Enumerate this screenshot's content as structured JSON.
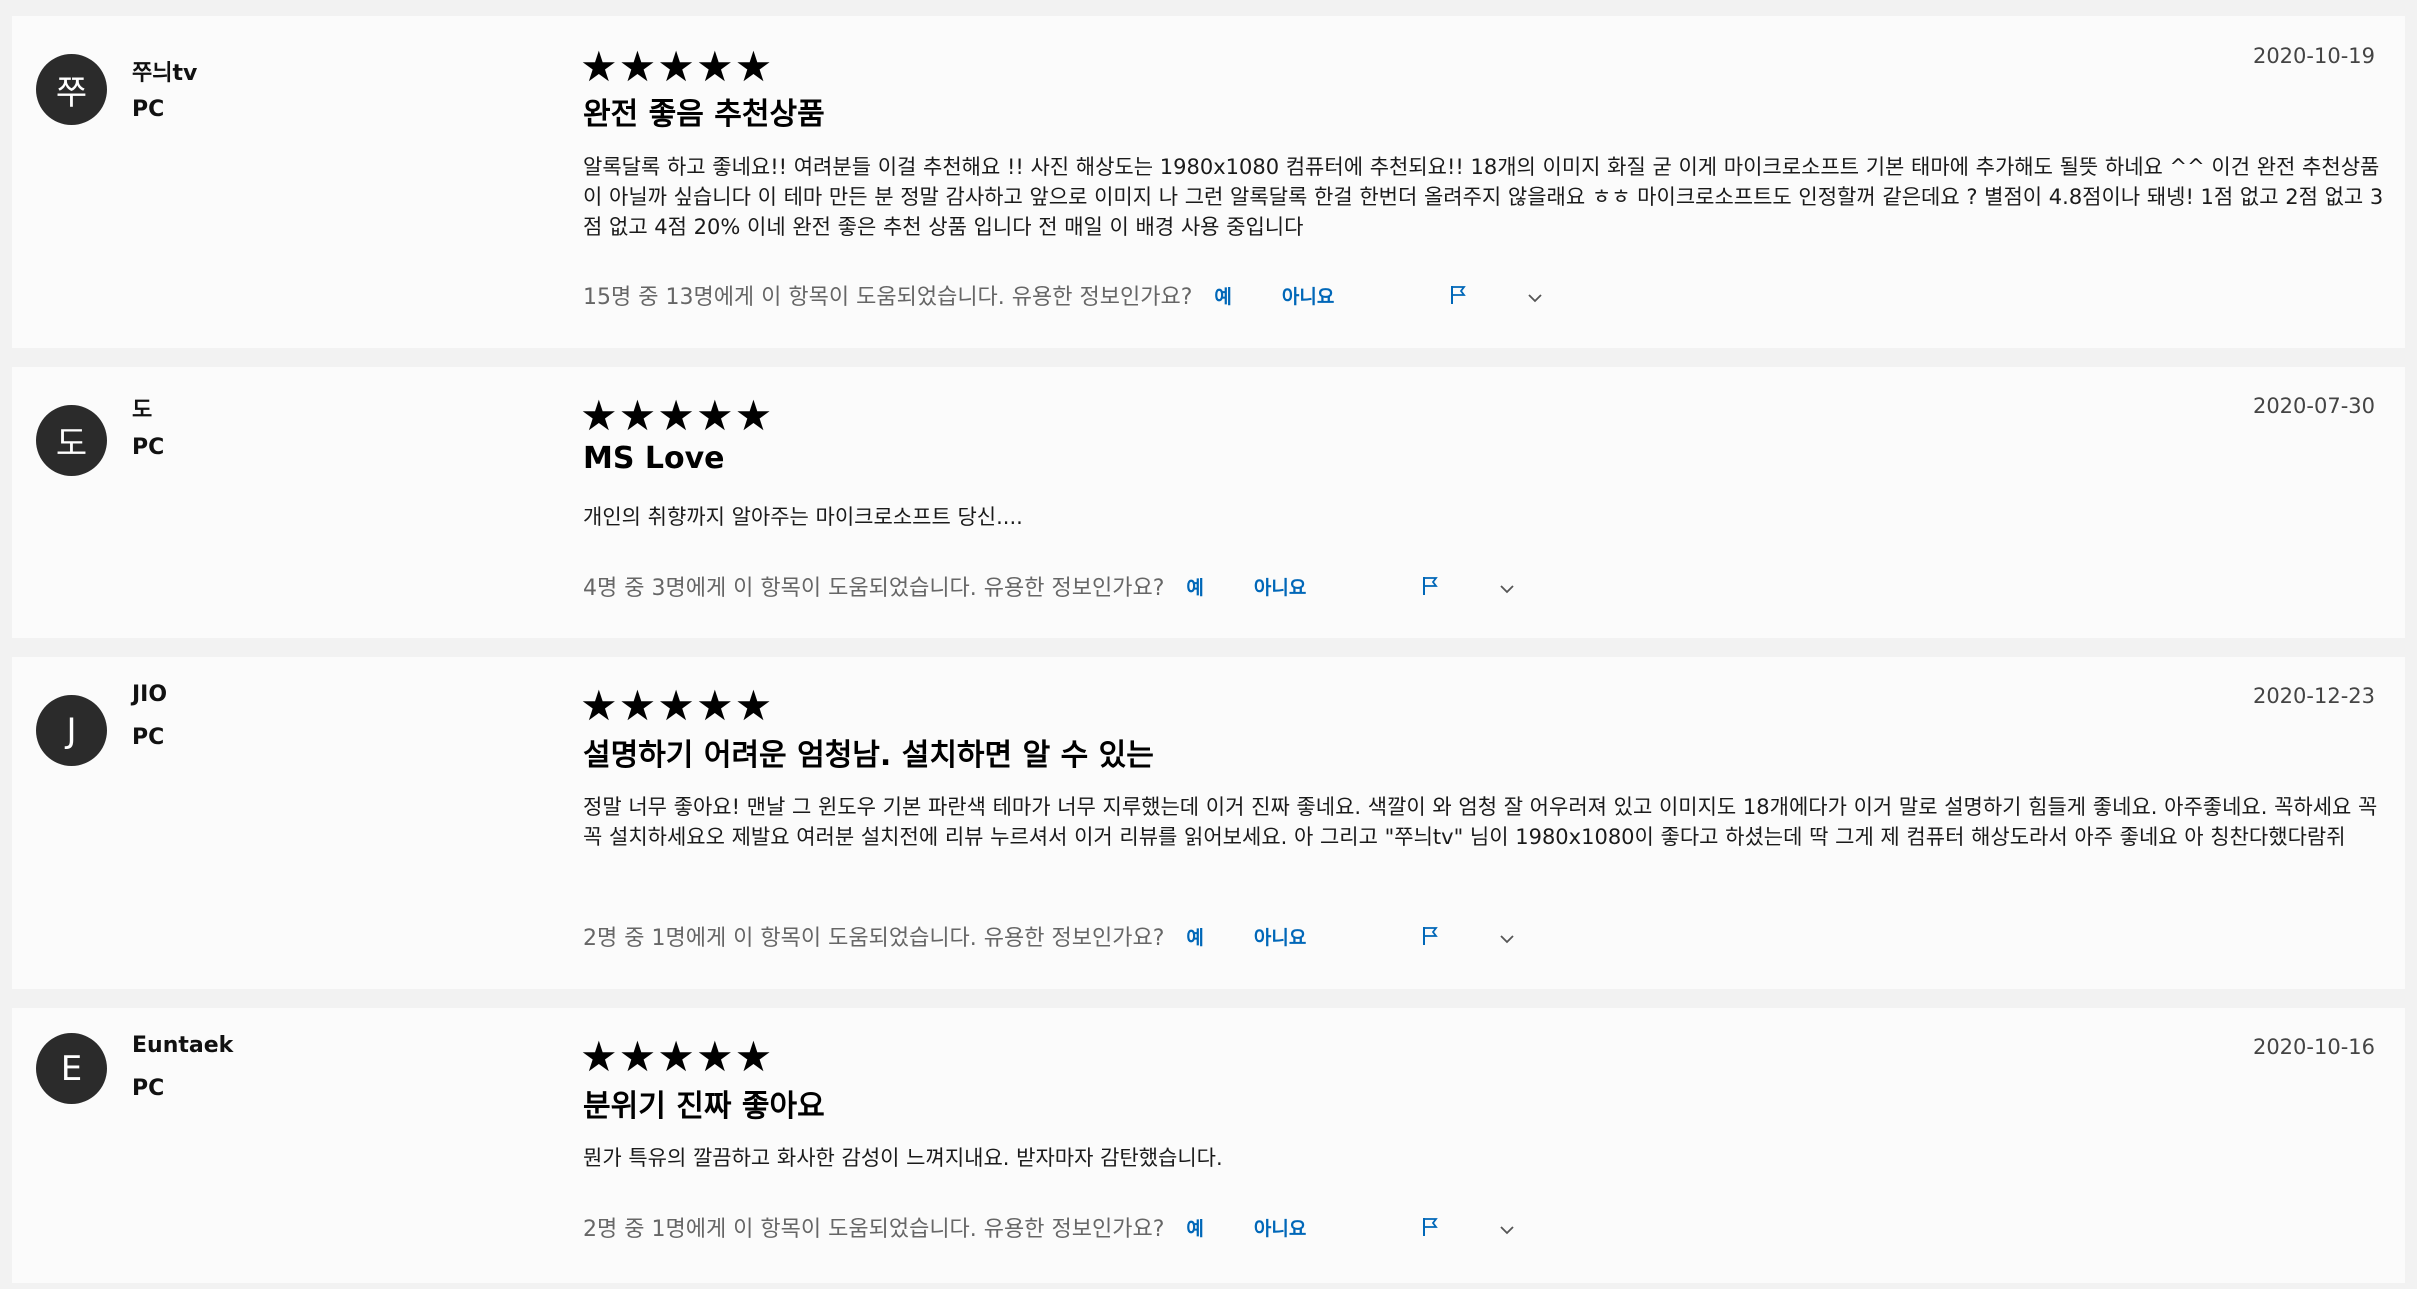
{
  "reviews": [
    {
      "avatar_letter": "쭈",
      "user": "쭈늬tv",
      "platform": "PC",
      "rating_display": "★★★★★",
      "title": "완전 좋음 추천상품",
      "body": "알록달록 하고 좋네요!! 여려분들 이걸 추천해요 !! 사진 해상도는 1980x1080 컴퓨터에 추천되요!! 18개의 이미지 화질 굳 이게 마이크로소프트 기본 태마에 추가해도 될뜻 하네요 ^^ 이건 완전 추천상품이 아닐까 싶습니다 이 테마 만든 분 정말 감사하고 앞으로 이미지 나 그런 알록달록 한걸 한번더 올려주지 않을래요 ㅎㅎ 마이크로소프트도 인정할꺼 같은데요 ? 별점이 4.8점이나 돼넹! 1점 없고 2점 없고 3점 없고 4점 20% 이네 완전 좋은 추천 상품 입니다 전 매일 이 배경 사용 중입니다",
      "date": "2020-10-19",
      "helpful_text": "15명 중 13명에게 이 항목이 도움되었습니다. 유용한 정보인가요?",
      "yes_label": "예",
      "no_label": "아니요"
    },
    {
      "avatar_letter": "도",
      "user": "도",
      "platform": "PC",
      "rating_display": "★★★★★",
      "title": "MS Love",
      "body": "개인의 취향까지 알아주는 마이크로소프트 당신....",
      "date": "2020-07-30",
      "helpful_text": "4명 중 3명에게 이 항목이 도움되었습니다. 유용한 정보인가요?",
      "yes_label": "예",
      "no_label": "아니요"
    },
    {
      "avatar_letter": "J",
      "user": "JIO",
      "platform": "PC",
      "rating_display": "★★★★★",
      "title": "설명하기 어려운 엄청남. 설치하면 알 수 있는",
      "body": "정말 너무 좋아요! 맨날 그 윈도우 기본 파란색 테마가 너무 지루했는데 이거 진짜 좋네요. 색깔이 와 엄청 잘 어우러져 있고 이미지도 18개에다가 이거 말로 설명하기 힘들게 좋네요. 아주좋네요. 꼭하세요 꼭꼭 설치하세요오 제발요 여러분 설치전에 리뷰 누르셔서 이거 리뷰를 읽어보세요. 아 그리고 \"쭈늬tv\" 님이 1980x1080이 좋다고 하셨는데 딱 그게 제 컴퓨터 해상도라서 아주 좋네요 아 칭찬다했다람쥐",
      "date": "2020-12-23",
      "helpful_text": "2명 중 1명에게 이 항목이 도움되었습니다. 유용한 정보인가요?",
      "yes_label": "예",
      "no_label": "아니요"
    },
    {
      "avatar_letter": "E",
      "user": "Euntaek",
      "platform": "PC",
      "rating_display": "★★★★★",
      "title": "분위기 진짜 좋아요",
      "body": "뭔가 특유의 깔끔하고 화사한 감성이 느껴지내요. 받자마자 감탄했습니다.",
      "date": "2020-10-16",
      "helpful_text": "2명 중 1명에게 이 항목이 도움되었습니다. 유용한 정보인가요?",
      "yes_label": "예",
      "no_label": "아니요"
    }
  ],
  "colors": {
    "page_background": "#f2f2f2",
    "card_background": "#fbfbfb",
    "avatar_background": "#2b2b2b",
    "link_blue": "#0067b8"
  },
  "icons": {
    "flag": "flag-icon",
    "expand": "chevron-down-icon"
  }
}
